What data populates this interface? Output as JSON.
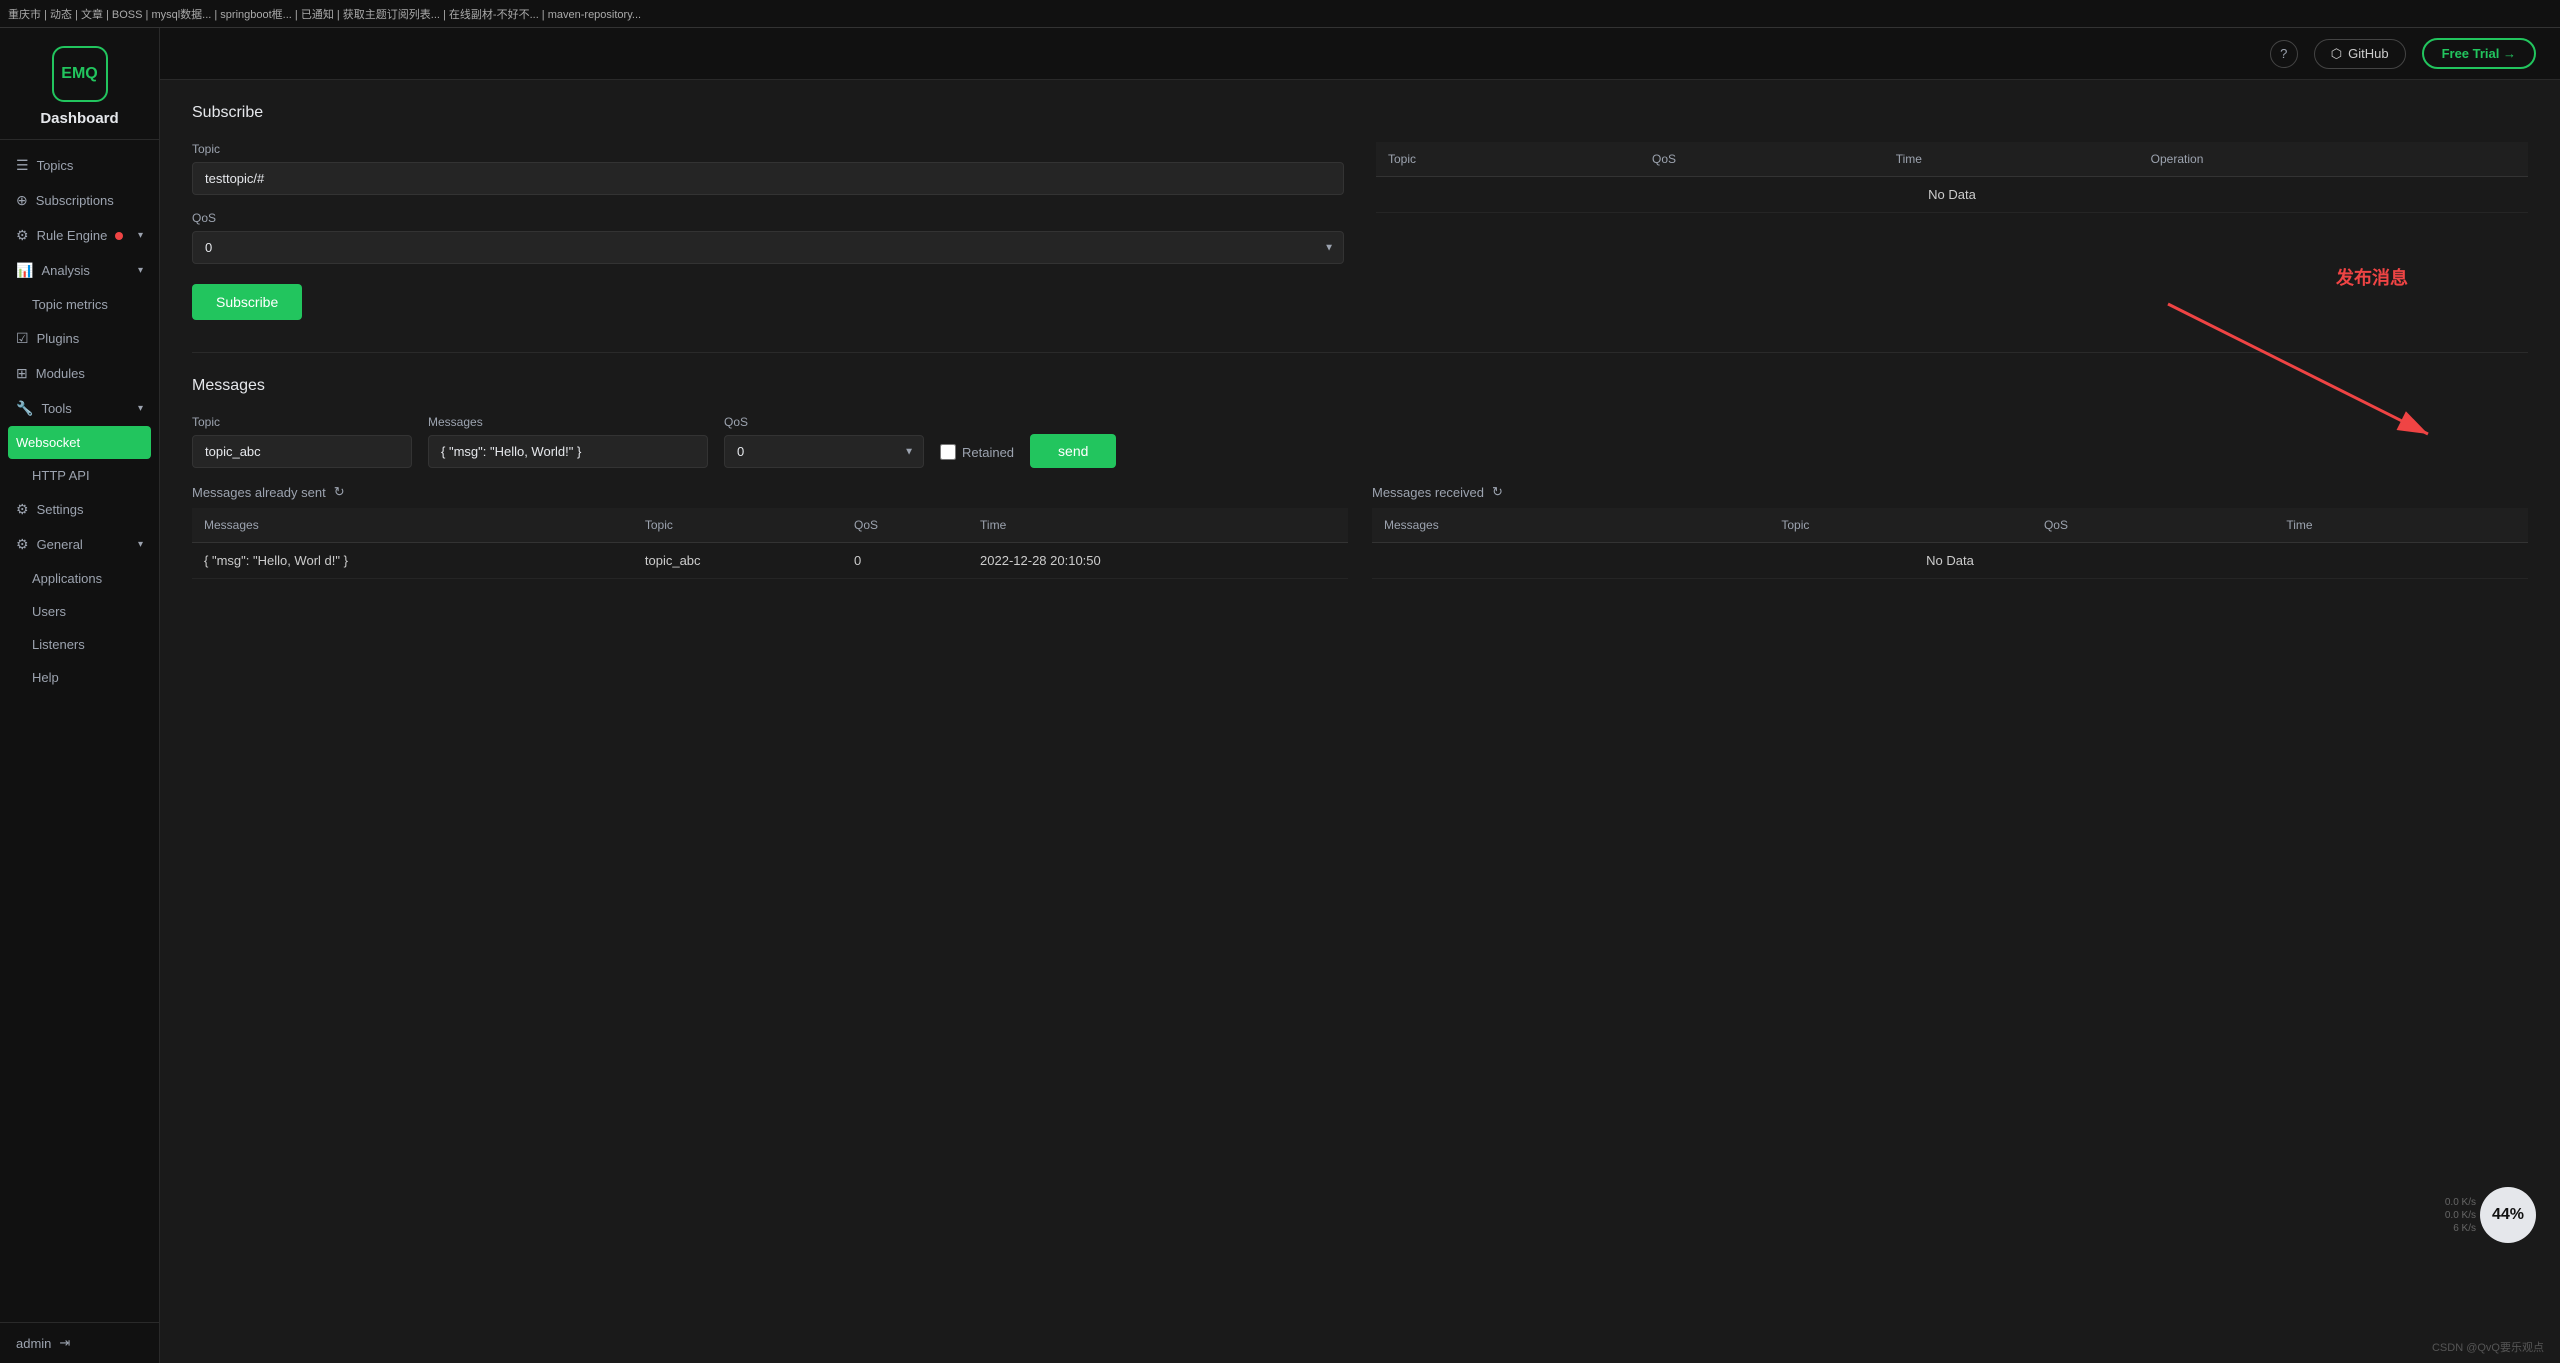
{
  "topbar": {
    "content": "重庆市 | 动态 | 文章 | BOSS | mysql数据... | springboot框... | 已通知 | 获取主题订阅列表... | 在线副材-不好不... | maven-repository..."
  },
  "header": {
    "help_label": "?",
    "github_label": "GitHub",
    "free_trial_label": "Free Trial →"
  },
  "sidebar": {
    "logo_text": "EMQ",
    "dashboard_label": "Dashboard",
    "nav_items": [
      {
        "id": "topics",
        "label": "Topics",
        "icon": "☰",
        "has_arrow": false
      },
      {
        "id": "subscriptions",
        "label": "Subscriptions",
        "icon": "⊕",
        "has_arrow": false
      },
      {
        "id": "rule-engine",
        "label": "Rule Engine",
        "icon": "⚙",
        "has_dot": true,
        "has_arrow": true
      },
      {
        "id": "analysis",
        "label": "Analysis",
        "icon": "📊",
        "has_arrow": true
      },
      {
        "id": "topic-metrics",
        "label": "Topic metrics",
        "icon": "",
        "is_sub": true
      },
      {
        "id": "plugins",
        "label": "Plugins",
        "icon": "☑",
        "has_arrow": false
      },
      {
        "id": "modules",
        "label": "Modules",
        "icon": "⊞",
        "has_arrow": false
      },
      {
        "id": "tools",
        "label": "Tools",
        "icon": "🔧",
        "has_arrow": true
      },
      {
        "id": "websocket",
        "label": "Websocket",
        "icon": "",
        "is_sub": true,
        "is_active": true
      },
      {
        "id": "http-api",
        "label": "HTTP API",
        "icon": "",
        "is_sub": true
      },
      {
        "id": "settings",
        "label": "Settings",
        "icon": "⚙",
        "has_arrow": false
      },
      {
        "id": "general",
        "label": "General",
        "icon": "⚙",
        "has_arrow": true
      },
      {
        "id": "applications",
        "label": "Applications",
        "icon": "",
        "is_sub": true
      },
      {
        "id": "users",
        "label": "Users",
        "icon": "",
        "is_sub": true
      },
      {
        "id": "listeners",
        "label": "Listeners",
        "icon": "",
        "is_sub": true
      },
      {
        "id": "help",
        "label": "Help",
        "icon": "",
        "is_sub": true
      }
    ],
    "admin_label": "admin",
    "logout_icon": "→"
  },
  "subscribe_section": {
    "title": "Subscribe",
    "topic_label": "Topic",
    "topic_value": "testtopic/#",
    "qos_label": "QoS",
    "qos_value": "0",
    "subscribe_btn": "Subscribe",
    "table": {
      "headers": [
        "Topic",
        "QoS",
        "Time",
        "Operation"
      ],
      "no_data": "No Data"
    }
  },
  "messages_section": {
    "title": "Messages",
    "topic_label": "Topic",
    "topic_value": "topic_abc",
    "messages_label": "Messages",
    "messages_value": "{ \"msg\": \"Hello, World!\" }",
    "qos_label": "QoS",
    "qos_value": "0",
    "retained_label": "Retained",
    "send_btn": "send",
    "annotation_text": "发布消息",
    "sent_table": {
      "header_label": "Messages already sent",
      "headers": [
        "Messages",
        "Topic",
        "QoS",
        "Time"
      ],
      "rows": [
        {
          "messages": "{ \"msg\": \"Hello, Worl d!\" }",
          "topic": "topic_abc",
          "qos": "0",
          "time": "2022-12-28 20:10:50"
        }
      ]
    },
    "received_table": {
      "header_label": "Messages received",
      "headers": [
        "Messages",
        "Topic",
        "QoS",
        "Time"
      ],
      "no_data": "No Data"
    }
  },
  "perf_widget": {
    "stat1": "0.0 K/s",
    "stat2": "0.0 K/s",
    "stat3": "6 K/s",
    "gauge_value": "44%"
  },
  "footer": {
    "credit": "CSDN @QvQ要乐观点"
  }
}
